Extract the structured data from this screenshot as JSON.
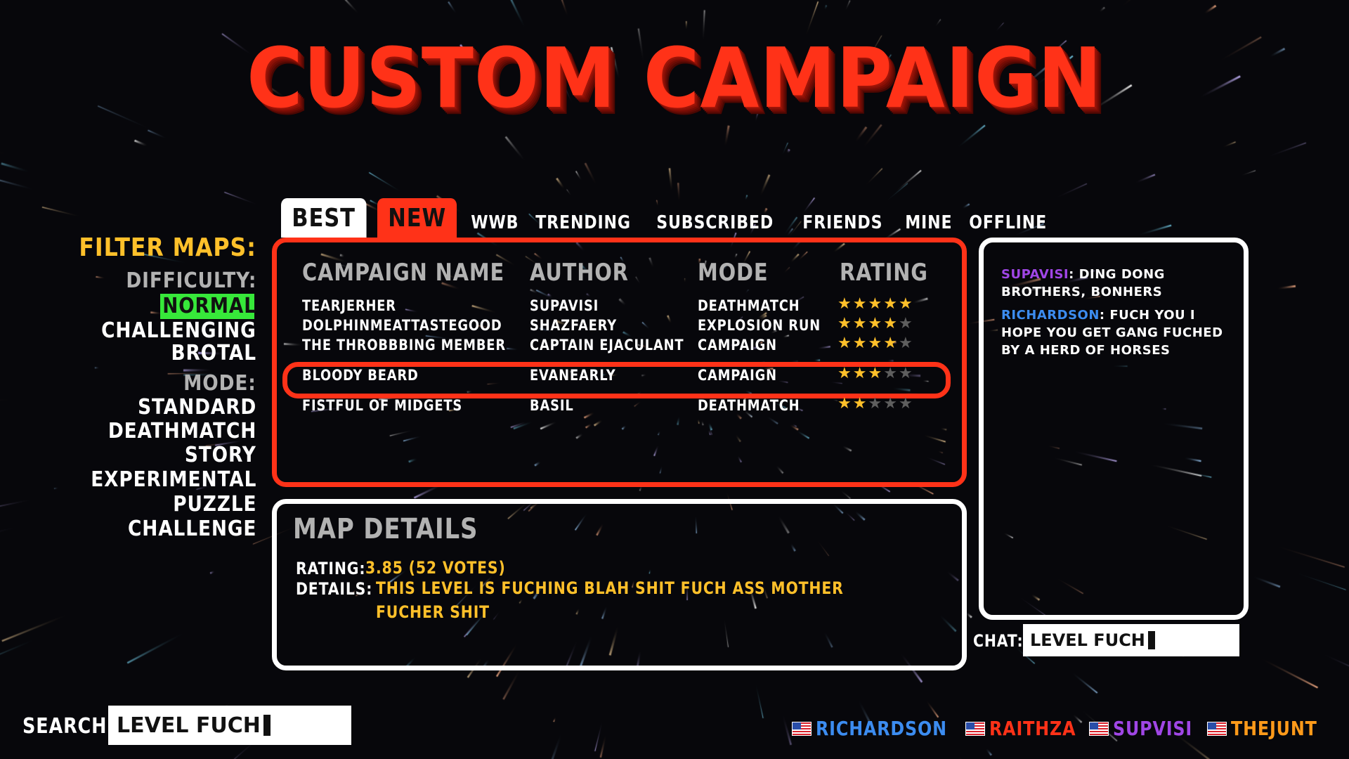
{
  "title": "CUSTOM CAMPAIGN",
  "tabs": [
    {
      "label": "BEST",
      "state": "active"
    },
    {
      "label": "NEW",
      "state": "highlighted"
    },
    {
      "label": "WWB"
    },
    {
      "label": "TRENDING"
    },
    {
      "label": "SUBSCRIBED"
    },
    {
      "label": "FRIENDS"
    },
    {
      "label": "MINE"
    },
    {
      "label": "OFFLINE"
    }
  ],
  "filters": {
    "title": "FILTER MAPS:",
    "difficulty_heading": "DIFFICULTY:",
    "difficulty": [
      "NORMAL",
      "CHALLENGING",
      "BROTAL"
    ],
    "difficulty_selected": "NORMAL",
    "mode_heading": "MODE:",
    "modes": [
      "STANDARD",
      "DEATHMATCH",
      "STORY",
      "EXPERIMENTAL",
      "PUZZLE",
      "CHALLENGE"
    ]
  },
  "table": {
    "headers": [
      "CAMPAIGN NAME",
      "AUTHOR",
      "MODE",
      "RATING"
    ],
    "rows": [
      {
        "name": "TEARJERHER",
        "author": "SUPAVISI",
        "mode": "DEATHMATCH",
        "stars": 5
      },
      {
        "name": "DOLPHINMEATTASTEGOOD",
        "author": "SHAZFAERY",
        "mode": "EXPLOSION RUN",
        "stars": 4
      },
      {
        "name": "THE THROBBBING MEMBER",
        "author": "CAPTAIN EJACULANT",
        "mode": "CAMPAIGN",
        "stars": 4
      },
      {
        "name": "BLOODY BEARD",
        "author": "EVANEARLY",
        "mode": "CAMPAIGN",
        "stars": 3,
        "selected": true
      },
      {
        "name": "FISTFUL OF MIDGETS",
        "author": "BASIL",
        "mode": "DEATHMATCH",
        "stars": 2
      }
    ],
    "max_stars": 5
  },
  "details": {
    "title": "MAP DETAILS",
    "rating_label": "RATING:",
    "rating_value": "3.85 (52 VOTES)",
    "details_label": "DETAILS:",
    "details_value": "THIS LEVEL IS FUCHING BLAH SHIT FUCH ASS MOTHER FUCHER SHIT"
  },
  "chat": {
    "messages": [
      {
        "user": "SUPAVISI",
        "user_color": "#a046e6",
        "text": "DING DONG BROTHERS, BONHERS"
      },
      {
        "user": "RICHARDSON",
        "user_color": "#3c8cf0",
        "text": "FUCH YOU I HOPE YOU GET GANG FUCHED BY A HERD OF HORSES"
      }
    ],
    "label": "CHAT:",
    "input_value": "LEVEL FUCH"
  },
  "search": {
    "label": "SEARCH:",
    "input_value": "LEVEL FUCH"
  },
  "players": [
    {
      "name": "RICHARDSON",
      "color": "#3c8cf0"
    },
    {
      "name": "RAITHZA",
      "color": "#ff3218"
    },
    {
      "name": "SUPVISI",
      "color": "#a046e6"
    },
    {
      "name": "THEJUNT",
      "color": "#ff9a1a"
    }
  ],
  "colors": {
    "accent_red": "#ff3218",
    "star_gold": "#ffc02a",
    "selected_green": "#37e83a",
    "heading_gray": "#b2b2b2"
  }
}
